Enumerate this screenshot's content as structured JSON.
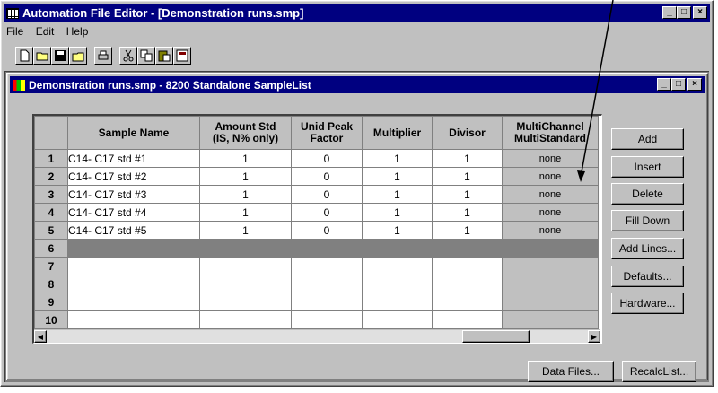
{
  "app": {
    "title": "Automation File Editor - [Demonstration runs.smp]",
    "menu": [
      "File",
      "Edit",
      "Help"
    ],
    "toolbar": [
      "new-icon",
      "open-icon",
      "save-icon",
      "open-folder-icon",
      "print-icon",
      "cut-icon",
      "copy-icon",
      "paste-icon",
      "import-icon"
    ]
  },
  "child": {
    "title": "Demonstration runs.smp - 8200 Standalone SampleList"
  },
  "table": {
    "headers": [
      {
        "line1": "Sample Name",
        "line2": ""
      },
      {
        "line1": "Amount Std",
        "line2": "(IS, N% only)"
      },
      {
        "line1": "Unid Peak",
        "line2": "Factor"
      },
      {
        "line1": "Multiplier",
        "line2": ""
      },
      {
        "line1": "Divisor",
        "line2": ""
      },
      {
        "line1": "MultiChannel",
        "line2": "MultiStandard"
      }
    ],
    "rows": [
      {
        "num": "1",
        "name": "C14- C17 std #1",
        "amount": "1",
        "unid": "0",
        "mult": "1",
        "div": "1",
        "mc": "none"
      },
      {
        "num": "2",
        "name": "C14- C17 std #2",
        "amount": "1",
        "unid": "0",
        "mult": "1",
        "div": "1",
        "mc": "none"
      },
      {
        "num": "3",
        "name": "C14- C17 std #3",
        "amount": "1",
        "unid": "0",
        "mult": "1",
        "div": "1",
        "mc": "none"
      },
      {
        "num": "4",
        "name": "C14- C17 std #4",
        "amount": "1",
        "unid": "0",
        "mult": "1",
        "div": "1",
        "mc": "none"
      },
      {
        "num": "5",
        "name": "C14- C17 std #5",
        "amount": "1",
        "unid": "0",
        "mult": "1",
        "div": "1",
        "mc": "none"
      },
      {
        "num": "6",
        "name": "",
        "amount": "",
        "unid": "",
        "mult": "",
        "div": "",
        "mc": ""
      },
      {
        "num": "7",
        "name": "",
        "amount": "",
        "unid": "",
        "mult": "",
        "div": "",
        "mc": ""
      },
      {
        "num": "8",
        "name": "",
        "amount": "",
        "unid": "",
        "mult": "",
        "div": "",
        "mc": ""
      },
      {
        "num": "9",
        "name": "",
        "amount": "",
        "unid": "",
        "mult": "",
        "div": "",
        "mc": ""
      },
      {
        "num": "10",
        "name": "",
        "amount": "",
        "unid": "",
        "mult": "",
        "div": "",
        "mc": ""
      }
    ]
  },
  "buttons": {
    "add": "Add",
    "insert": "Insert",
    "delete": "Delete",
    "fill_down": "Fill Down",
    "add_lines": "Add Lines...",
    "defaults": "Defaults...",
    "hardware": "Hardware...",
    "data_files": "Data Files...",
    "recalc_list": "RecalcList..."
  },
  "colors": {
    "titlebar": "#000080",
    "face": "#c0c0c0",
    "selected_row": "#808080"
  }
}
